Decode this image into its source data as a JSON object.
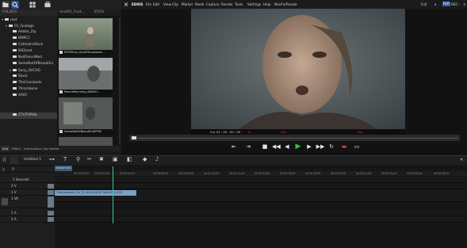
{
  "app": {
    "edius_logo": "EDIUS",
    "menus": [
      "File",
      "Edit",
      "View",
      "Clip",
      "Marker",
      "Mode",
      "Capture",
      "Render",
      "Tools",
      "Settings",
      "Help",
      "NonForResale"
    ],
    "mode_label": "Full",
    "plr": "PLR",
    "rec": "REC"
  },
  "bin": {
    "tabs": [
      "FOLDER"
    ],
    "path_label": "mod01_Foot...",
    "zoom": "350%",
    "tree": [
      {
        "label": "root",
        "indent": 0
      },
      {
        "label": "01_Footage",
        "indent": 1
      },
      {
        "label": "Adobe_Zip",
        "indent": 2
      },
      {
        "label": "BMPCC",
        "indent": 2
      },
      {
        "label": "CathedralRock",
        "indent": 2
      },
      {
        "label": "MiGhost",
        "indent": 2
      },
      {
        "label": "NeilDoorsMed",
        "indent": 2
      },
      {
        "label": "SomeNotOfBeautiful",
        "indent": 2
      },
      {
        "label": "Sony_AVCHD",
        "indent": 2
      },
      {
        "label": "Stock",
        "indent": 2
      },
      {
        "label": "TheConstants",
        "indent": 2
      },
      {
        "label": "Thrombone",
        "indent": 2
      },
      {
        "label": "XAVC",
        "indent": 2
      },
      {
        "label": "ZTUTORIAL",
        "indent": 2
      }
    ],
    "thumbs": [
      {
        "caption": "MTSFilms_GymFitCoolsonic..."
      },
      {
        "caption": "PearceMunning_DIMHO..."
      },
      {
        "caption": "SomeNotOfBeautifulMTSB"
      }
    ]
  },
  "left_tabs": [
    "Info",
    "Effect",
    "Information",
    "Clip marker"
  ],
  "player": {
    "timecode_label": "Cur 01 : 00 : 00 : 00",
    "in_label": "In",
    "out_label": "Out",
    "dur_label": "Dur"
  },
  "timeline": {
    "sequence_name": "Untitled 1",
    "sequence_tab": "Sequence1",
    "seconds_label": "5 Seconds",
    "ruler": [
      "00:00:00;00",
      "00:00:02;00",
      "00:00:04;00",
      "00:00:06;00",
      "00:00:08;00",
      "00:00:10;00",
      "00:00:12;00",
      "00:00:14;00",
      "00:00:16;00",
      "00:00:18;00",
      "00:00:20;00",
      "00:00:22;00",
      "00:00:24;00",
      "00:00:26;00",
      "00:00:28;00"
    ],
    "tracks": [
      "",
      "2 V",
      "1 V",
      "1 VA",
      "",
      "1 A",
      "2 A"
    ],
    "clip_label": "TheConstants_CU_TL 00:00:00;00 Ta00:00:11;00"
  }
}
